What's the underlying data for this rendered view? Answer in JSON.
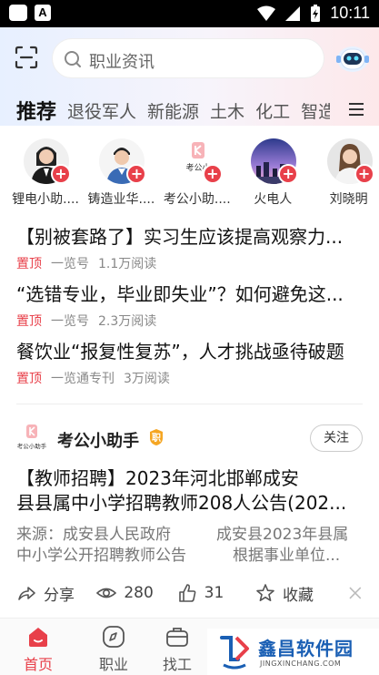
{
  "status_bar": {
    "time": "10:11"
  },
  "search": {
    "placeholder": "职业资讯"
  },
  "tabs": [
    "推荐",
    "退役军人",
    "新能源",
    "土木",
    "化工",
    "智造"
  ],
  "authors": [
    {
      "name": "锂电小助...."
    },
    {
      "name": "铸造业华...."
    },
    {
      "name": "考公小助....",
      "logo_text": "考公小"
    },
    {
      "name": "火电人"
    },
    {
      "name": "刘晓明"
    }
  ],
  "articles": [
    {
      "title": "【别被套路了】实习生应该提高观察力...",
      "pin": "置顶",
      "source": "一览号",
      "reads": "1.1万阅读"
    },
    {
      "title": "“选错专业，毕业即失业”？如何避免这...",
      "pin": "置顶",
      "source": "一览号",
      "reads": "2.3万阅读"
    },
    {
      "title": "餐饮业“报复性复苏”，人才挑战亟待破题",
      "pin": "置顶",
      "source": "一览通专刊",
      "reads": "3万阅读"
    }
  ],
  "card": {
    "author": "考公小助手",
    "logo_text": "考公小助手",
    "badge": "职",
    "follow": "关注",
    "title_line1": "【教师招聘】2023年河北邯郸成安",
    "title_line2": "县县属中小学招聘教师208人公告(202...",
    "snippet_r1c1": "来源：成安县人民政府",
    "snippet_r1c2": "成安县2023年县属",
    "snippet_r2c1": "中小学公开招聘教师公告",
    "snippet_r2c2": "根据事业单位...",
    "share": "分享",
    "views": "280",
    "likes": "31",
    "collect": "收藏"
  },
  "nav": [
    {
      "label": "首页"
    },
    {
      "label": "职业"
    },
    {
      "label": "找工"
    }
  ],
  "watermark": {
    "title": "鑫昌软件园",
    "sub": "JINGXINCHANG.COM"
  },
  "colors": {
    "accent": "#e8404a",
    "brand_blue": "#1a5fb4"
  }
}
